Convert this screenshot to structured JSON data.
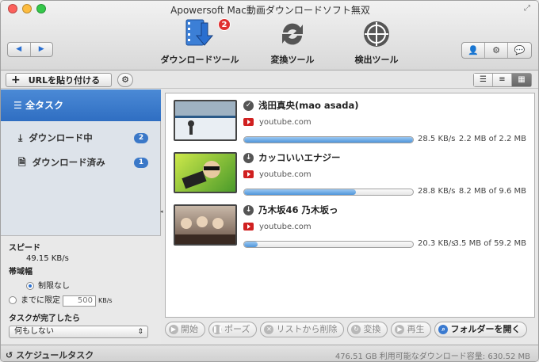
{
  "window": {
    "title": "Apowersoft Mac動画ダウンロードソフト無双"
  },
  "nav": {
    "back": "◀",
    "forward": "▶"
  },
  "toolbar": {
    "download_label": "ダウンロードツール",
    "download_badge": "2",
    "convert_label": "変換ツール",
    "detect_label": "検出ツール"
  },
  "subbar": {
    "paste_url": "URLを貼り付ける",
    "paste_plus": "+"
  },
  "sidebar": {
    "all_tasks": "全タスク",
    "items": [
      {
        "label": "ダウンロード中",
        "count": "2"
      },
      {
        "label": "ダウンロード済み",
        "count": "1"
      }
    ]
  },
  "speed_panel": {
    "speed_label": "スピード",
    "speed_value": "49.15 KB/s",
    "bandwidth_label": "帯域幅",
    "unlimited": "制限なし",
    "limit_to": "までに限定",
    "limit_value": "500",
    "limit_unit": "KB/s",
    "when_done_label": "タスクが完了したら",
    "when_done_value": "何もしない"
  },
  "downloads": [
    {
      "title": "浅田真央(mao asada)",
      "source": "youtube.com",
      "progress": 1.0,
      "speed": "28.5 KB/s",
      "size": "2.2 MB of  2.2 MB",
      "status": "✓",
      "thumb_color": "#d7e3ea"
    },
    {
      "title": "カッコいいエナジー",
      "source": "youtube.com",
      "progress": 0.66,
      "speed": "28.8 KB/s",
      "size": "8.2 MB of  9.6 MB",
      "status": "↓",
      "thumb_color": "#8bc34a"
    },
    {
      "title": "乃木坂46 乃木坂っ",
      "source": "youtube.com",
      "progress": 0.08,
      "speed": "20.3 KB/s",
      "size": "3.5 MB of 59.2 MB",
      "status": "↓",
      "thumb_color": "#a08a7a"
    }
  ],
  "actions": {
    "start": "開始",
    "pause": "ポーズ",
    "remove": "リストから削除",
    "convert": "変換",
    "play": "再生",
    "open_folder": "フォルダーを開く"
  },
  "status": {
    "schedule": "スケジュールタスク",
    "disk": "476.51 GB 利用可能なダウンロード容量: 630.52 MB"
  },
  "colors": {
    "accent": "#3a78c8",
    "selected": "#3f7fcc"
  }
}
